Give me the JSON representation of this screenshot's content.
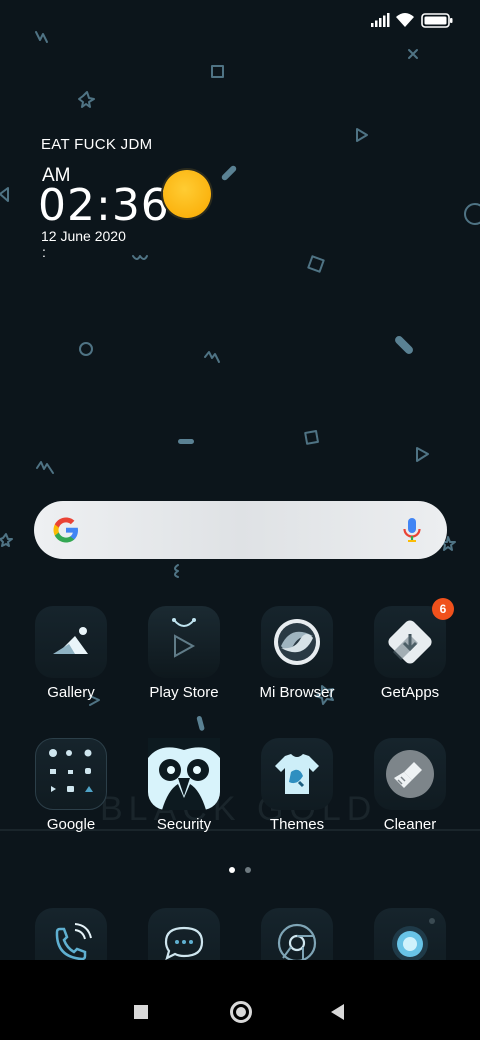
{
  "status_bar": {
    "icons": [
      "signal-icon",
      "wifi-icon",
      "battery-icon"
    ]
  },
  "widget": {
    "title": "EAT FUCK JDM",
    "ampm": "AM",
    "time": "02:36",
    "date": "12 June 2020",
    "extra": ":",
    "weather_icon": "sun-icon"
  },
  "search": {
    "google_icon": "google-g-icon",
    "mic_icon": "mic-icon"
  },
  "apps_row1": [
    {
      "label": "Gallery",
      "icon": "gallery-icon"
    },
    {
      "label": "Play Store",
      "icon": "play-store-icon"
    },
    {
      "label": "Mi Browser",
      "icon": "browser-icon"
    },
    {
      "label": "GetApps",
      "icon": "getapps-icon",
      "badge": "6"
    }
  ],
  "apps_row2": [
    {
      "label": "Google",
      "icon": "google-folder-icon"
    },
    {
      "label": "Security",
      "icon": "security-owl-icon"
    },
    {
      "label": "Themes",
      "icon": "themes-shirt-icon"
    },
    {
      "label": "Cleaner",
      "icon": "cleaner-brush-icon"
    }
  ],
  "page_indicator": {
    "pages": 2,
    "current": 1
  },
  "dock": [
    "phone-icon",
    "messages-icon",
    "chrome-icon",
    "camera-icon"
  ],
  "nav": [
    "recents-button",
    "home-button",
    "back-button"
  ],
  "colors": {
    "badge": "#f0511c",
    "sun": "#fbb30f",
    "background": "#0c151b",
    "accent": "#4f7384"
  }
}
